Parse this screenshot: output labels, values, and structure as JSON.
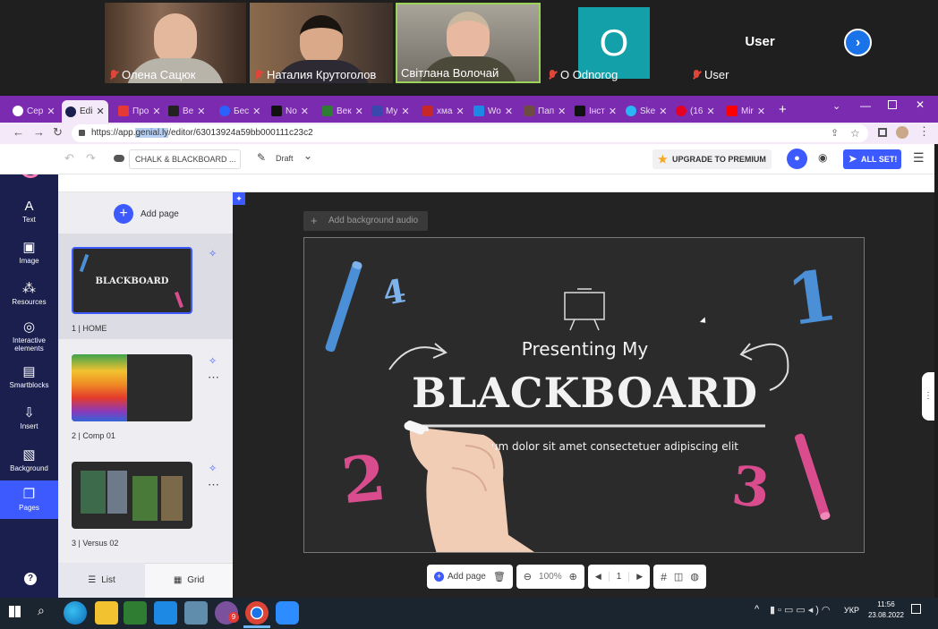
{
  "participants": [
    {
      "name": "Олена Сацюк",
      "muted": true
    },
    {
      "name": "Наталия Крутоголов",
      "muted": true
    },
    {
      "name": "Світлана Волочай",
      "muted": false
    },
    {
      "name": "O Odnorog",
      "muted": true,
      "initial": "O"
    },
    {
      "name": "User",
      "muted": true,
      "top_label": "User"
    }
  ],
  "browser": {
    "tabs": [
      {
        "label": "Сер"
      },
      {
        "label": "Edi"
      },
      {
        "label": "Про"
      },
      {
        "label": "Ве"
      },
      {
        "label": "Бес"
      },
      {
        "label": "No"
      },
      {
        "label": "Век"
      },
      {
        "label": "My"
      },
      {
        "label": "хма"
      },
      {
        "label": "Wo"
      },
      {
        "label": "Пап"
      },
      {
        "label": "Інст"
      },
      {
        "label": "Ske"
      },
      {
        "label": "(16"
      },
      {
        "label": "Mir"
      }
    ],
    "url_prefix": "https://app.",
    "url_highlight": "genial.ly",
    "url_suffix": "/editor/63013924a59bb000111c23c2"
  },
  "editor": {
    "project_name": "CHALK & BLACKBOARD ...",
    "status": "Draft",
    "upgrade_label": "UPGRADE TO PREMIUM",
    "all_set_label": "ALL SET!",
    "add_page_label": "Add page",
    "add_audio_label": "Add background audio",
    "nav": [
      {
        "label": "Text"
      },
      {
        "label": "Image"
      },
      {
        "label": "Resources"
      },
      {
        "label": "Interactive elements"
      },
      {
        "label": "Smartblocks"
      },
      {
        "label": "Insert"
      },
      {
        "label": "Background"
      },
      {
        "label": "Pages"
      }
    ],
    "pages": [
      {
        "label": "1 | HOME"
      },
      {
        "label": "2 | Comp 01"
      },
      {
        "label": "3 | Versus 02"
      }
    ],
    "view_list": "List",
    "view_grid": "Grid",
    "zoom": "100%",
    "page_number": "1",
    "bottom_add_page": "Add page"
  },
  "slide": {
    "title_small": "Presenting My",
    "title_big": "BLACKBOARD",
    "subtitle": "Lorem ipsum dolor sit amet consectetuer adipiscing elit",
    "numbers": [
      "4",
      "1",
      "2",
      "3"
    ]
  },
  "taskbar": {
    "lang": "УКР",
    "time": "11:56",
    "date": "23.08.2022",
    "notification_count": "9"
  },
  "colors": {
    "chrome_purple": "#7b2bb0",
    "nav_dark": "#1a1f4e",
    "accent_blue": "#3d5afe",
    "chalk_blue": "#4b8fd6",
    "chalk_pink": "#d94d8e"
  }
}
